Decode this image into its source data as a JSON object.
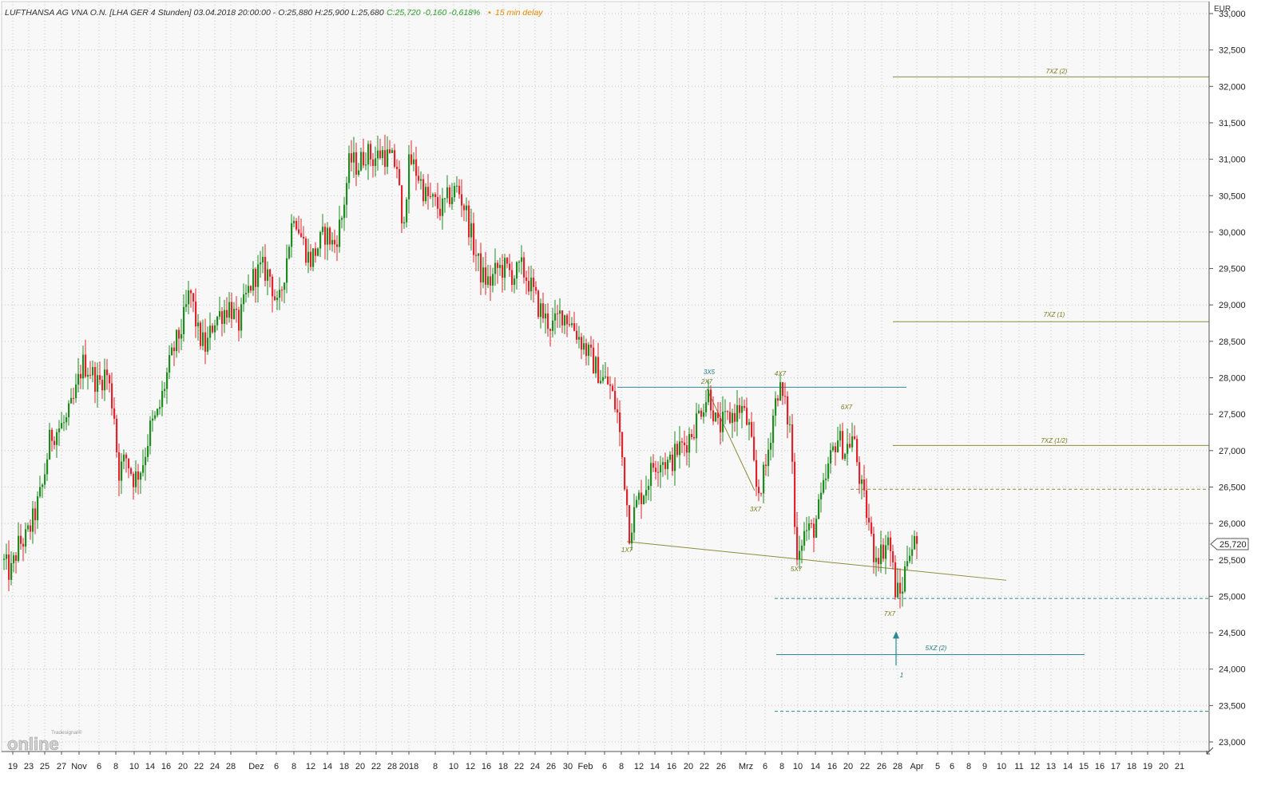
{
  "header": {
    "title": "LUFTHANSA AG VNA O.N. [LHA GER 4 Stunden] 03.04.2018 20:00:00 - O:25,880 H:25,900 L:25,680",
    "change": "C:25,720 -0,160 -0,618%",
    "bullet": "•",
    "delay": "15 min delay"
  },
  "currency": "EUR",
  "last_price_label": "25,720",
  "logo": {
    "small": "Tradesignal®",
    "big": "online"
  },
  "colors": {
    "up": "#1e8c1e",
    "down": "#e0242d",
    "olive": "#8c8c3c",
    "teal": "#2b8a93",
    "header_green": "#2ca02c",
    "delay_orange": "#e58a00"
  },
  "chart_data": {
    "type": "candlestick",
    "title": "LUFTHANSA AG VNA O.N. [LHA GER 4 Stunden]",
    "y_axis": {
      "unit": "EUR",
      "ylim": [
        22.9,
        33.0
      ],
      "ticks": [
        "23,000",
        "23,500",
        "24,000",
        "24,500",
        "25,000",
        "25,500",
        "26,000",
        "26,500",
        "27,000",
        "27,500",
        "28,000",
        "28,500",
        "29,000",
        "29,500",
        "30,000",
        "30,500",
        "31,000",
        "31,500",
        "32,000",
        "32,500",
        "33,000"
      ],
      "grid": true
    },
    "x_axis": {
      "labels": [
        "19",
        "23",
        "25",
        "27",
        "Nov",
        "6",
        "8",
        "10",
        "14",
        "16",
        "20",
        "22",
        "24",
        "28",
        "Dez",
        "6",
        "8",
        "12",
        "14",
        "18",
        "20",
        "22",
        "28",
        "2018",
        "8",
        "10",
        "12",
        "16",
        "18",
        "22",
        "24",
        "26",
        "30",
        "Feb",
        "6",
        "8",
        "12",
        "14",
        "16",
        "20",
        "22",
        "26",
        "Mrz",
        "6",
        "8",
        "10",
        "14",
        "16",
        "20",
        "22",
        "26",
        "28",
        "Apr",
        "5",
        "6",
        "8",
        "9",
        "10",
        "11",
        "12",
        "13",
        "14",
        "15",
        "16",
        "17",
        "18",
        "19",
        "20",
        "21"
      ],
      "grid": true
    },
    "price_path": [
      [
        0,
        25.5
      ],
      [
        10,
        25.3
      ],
      [
        20,
        25.7
      ],
      [
        30,
        25.8
      ],
      [
        40,
        26.1
      ],
      [
        50,
        26.5
      ],
      [
        60,
        27.2
      ],
      [
        70,
        27.3
      ],
      [
        80,
        27.4
      ],
      [
        90,
        27.7
      ],
      [
        100,
        28.2
      ],
      [
        110,
        28.1
      ],
      [
        120,
        27.9
      ],
      [
        130,
        28.1
      ],
      [
        140,
        27.5
      ],
      [
        145,
        26.7
      ],
      [
        155,
        26.9
      ],
      [
        165,
        26.6
      ],
      [
        175,
        26.8
      ],
      [
        185,
        27.3
      ],
      [
        195,
        27.5
      ],
      [
        205,
        28.0
      ],
      [
        215,
        28.4
      ],
      [
        225,
        28.7
      ],
      [
        235,
        29.2
      ],
      [
        245,
        28.6
      ],
      [
        255,
        28.4
      ],
      [
        265,
        28.8
      ],
      [
        275,
        28.9
      ],
      [
        285,
        29.0
      ],
      [
        295,
        28.7
      ],
      [
        305,
        29.1
      ],
      [
        315,
        29.4
      ],
      [
        325,
        29.5
      ],
      [
        335,
        29.4
      ],
      [
        345,
        28.9
      ],
      [
        355,
        29.6
      ],
      [
        365,
        30.3
      ],
      [
        375,
        29.9
      ],
      [
        385,
        29.6
      ],
      [
        395,
        29.8
      ],
      [
        405,
        30.0
      ],
      [
        415,
        29.8
      ],
      [
        425,
        30.2
      ],
      [
        435,
        31.0
      ],
      [
        445,
        30.9
      ],
      [
        455,
        31.1
      ],
      [
        465,
        31.0
      ],
      [
        475,
        31.1
      ],
      [
        485,
        31.0
      ],
      [
        495,
        30.9
      ],
      [
        500,
        30.0
      ],
      [
        510,
        31.0
      ],
      [
        520,
        30.8
      ],
      [
        530,
        30.5
      ],
      [
        540,
        30.4
      ],
      [
        550,
        30.3
      ],
      [
        560,
        30.5
      ],
      [
        570,
        30.6
      ],
      [
        580,
        30.3
      ],
      [
        590,
        29.8
      ],
      [
        600,
        29.4
      ],
      [
        610,
        29.3
      ],
      [
        620,
        29.5
      ],
      [
        630,
        29.5
      ],
      [
        640,
        29.4
      ],
      [
        650,
        29.5
      ],
      [
        660,
        29.3
      ],
      [
        670,
        29.0
      ],
      [
        680,
        28.8
      ],
      [
        690,
        28.7
      ],
      [
        700,
        28.9
      ],
      [
        710,
        28.8
      ],
      [
        720,
        28.6
      ],
      [
        730,
        28.4
      ],
      [
        740,
        28.2
      ],
      [
        750,
        28.0
      ],
      [
        760,
        27.9
      ],
      [
        770,
        27.5
      ],
      [
        780,
        26.5
      ],
      [
        785,
        25.9
      ],
      [
        795,
        26.3
      ],
      [
        805,
        26.5
      ],
      [
        815,
        26.8
      ],
      [
        825,
        26.9
      ],
      [
        835,
        26.8
      ],
      [
        845,
        27.0
      ],
      [
        855,
        27.1
      ],
      [
        865,
        27.3
      ],
      [
        875,
        27.6
      ],
      [
        885,
        27.8
      ],
      [
        895,
        27.3
      ],
      [
        905,
        27.4
      ],
      [
        915,
        27.5
      ],
      [
        925,
        27.6
      ],
      [
        935,
        27.3
      ],
      [
        945,
        26.4
      ],
      [
        955,
        26.7
      ],
      [
        965,
        27.5
      ],
      [
        972,
        27.9
      ],
      [
        980,
        27.6
      ],
      [
        988,
        27.2
      ],
      [
        993,
        25.6
      ],
      [
        1005,
        25.9
      ],
      [
        1015,
        25.9
      ],
      [
        1025,
        26.3
      ],
      [
        1035,
        26.8
      ],
      [
        1045,
        27.2
      ],
      [
        1055,
        27.0
      ],
      [
        1065,
        27.2
      ],
      [
        1075,
        26.5
      ],
      [
        1085,
        26.0
      ],
      [
        1090,
        25.6
      ],
      [
        1100,
        25.6
      ],
      [
        1110,
        25.8
      ],
      [
        1118,
        25.1
      ],
      [
        1125,
        25.0
      ],
      [
        1135,
        25.7
      ],
      [
        1145,
        25.72
      ]
    ],
    "annotations": [
      {
        "label": "1X7",
        "x": "8 Feb",
        "y": 25.7
      },
      {
        "label": "2X7",
        "x": "22 Feb",
        "y": 27.8
      },
      {
        "label": "3X5",
        "x": "22 Feb",
        "y": 27.85
      },
      {
        "label": "3X7",
        "x": "6 Mrz",
        "y": 26.3
      },
      {
        "label": "4X7",
        "x": "8 Mrz",
        "y": 27.9
      },
      {
        "label": "5X7",
        "x": "10 Mrz",
        "y": 25.4
      },
      {
        "label": "6X7",
        "x": "20 Mrz",
        "y": 27.4
      },
      {
        "label": "7X7",
        "x": "28 Mrz",
        "y": 24.9
      },
      {
        "label": "7XZ (2)",
        "y": 32.13
      },
      {
        "label": "7XZ (1)",
        "y": 28.77
      },
      {
        "label": "7XZ (1/2)",
        "y": 27.07
      },
      {
        "label": "5XZ (2)",
        "y": 24.2
      },
      {
        "label": "1",
        "y": 24.0
      }
    ],
    "levels": [
      {
        "name": "7XZ (2)",
        "y": 32.13,
        "style": "solid",
        "color": "olive"
      },
      {
        "name": "7XZ (1)",
        "y": 28.77,
        "style": "solid",
        "color": "olive"
      },
      {
        "name": "resistance",
        "y": 27.87,
        "style": "solid",
        "color": "teal"
      },
      {
        "name": "7XZ (1/2)",
        "y": 27.07,
        "style": "solid",
        "color": "olive"
      },
      {
        "name": "dashed-1",
        "y": 26.47,
        "style": "dashed",
        "color": "olive"
      },
      {
        "name": "dashed-2",
        "y": 24.97,
        "style": "dashed",
        "color": "teal"
      },
      {
        "name": "5XZ (2)",
        "y": 24.2,
        "style": "solid",
        "color": "teal"
      },
      {
        "name": "dashed-3",
        "y": 23.42,
        "style": "dashed",
        "color": "teal"
      }
    ],
    "trendlines": [
      {
        "name": "lower-trendline",
        "from": [
          25.75
        ],
        "to": [
          25.22
        ]
      },
      {
        "name": "diagonal",
        "from": [
          27.85
        ],
        "to": [
          26.45
        ]
      }
    ]
  }
}
